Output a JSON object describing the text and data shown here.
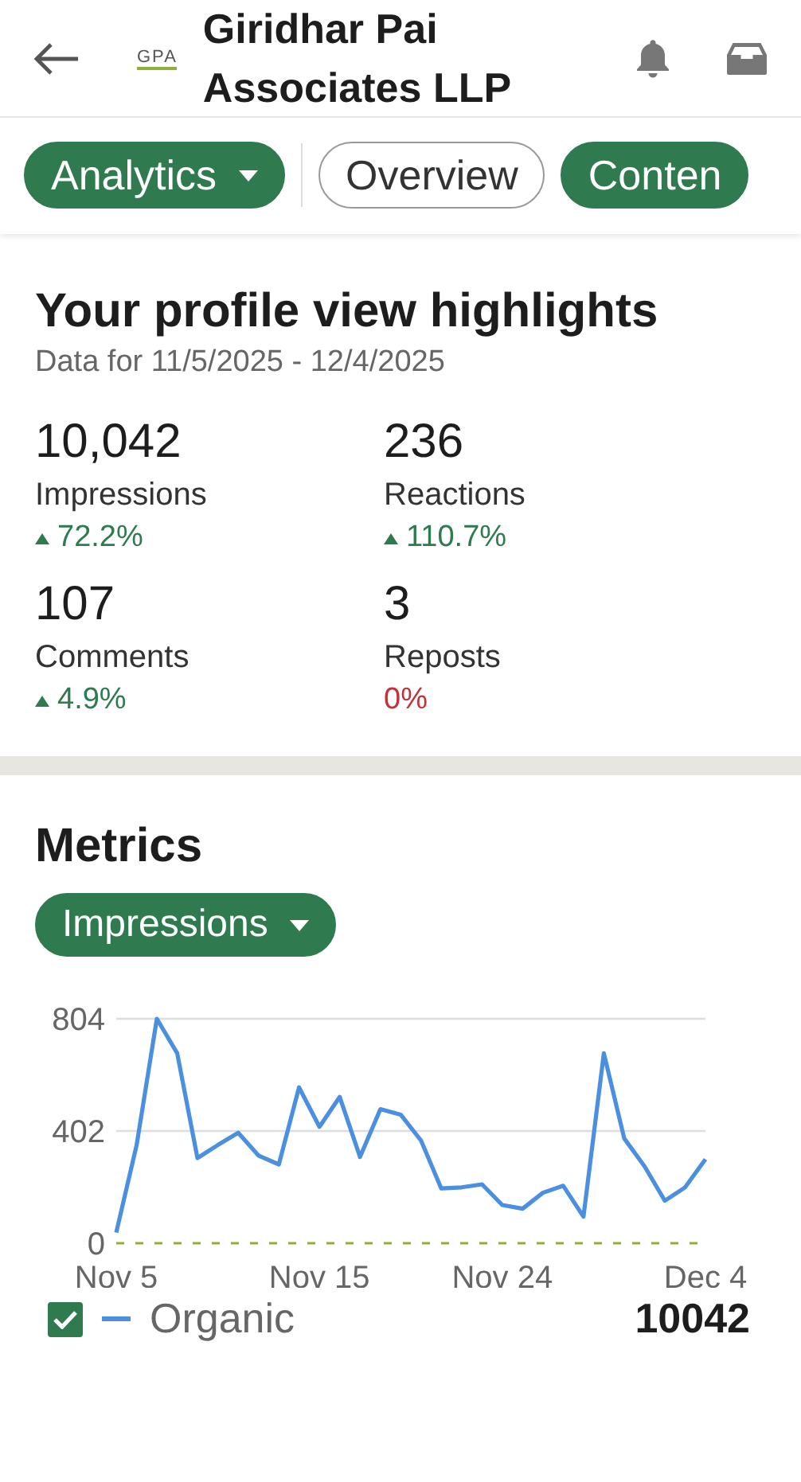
{
  "header": {
    "logo_text": "GPA",
    "title": "Giridhar Pai Associates LLP"
  },
  "chips": [
    {
      "label": "Analytics",
      "kind": "menu"
    },
    {
      "label": "Overview",
      "kind": "outline"
    },
    {
      "label": "Conten",
      "kind": "filled"
    }
  ],
  "highlights": {
    "title": "Your profile view highlights",
    "subtitle": "Data for 11/5/2025 - 12/4/2025",
    "stats": [
      {
        "value": "10,042",
        "label": "Impressions",
        "change": "72.2%",
        "kind": "up"
      },
      {
        "value": "236",
        "label": "Reactions",
        "change": "110.7%",
        "kind": "up"
      },
      {
        "value": "107",
        "label": "Comments",
        "change": "4.9%",
        "kind": "up"
      },
      {
        "value": "3",
        "label": "Reposts",
        "change": "0%",
        "kind": "flat"
      }
    ]
  },
  "metrics": {
    "title": "Metrics",
    "dropdown": "Impressions",
    "chart_data": {
      "type": "line",
      "categories": [
        "Nov 5",
        null,
        null,
        null,
        null,
        null,
        null,
        null,
        null,
        null,
        "Nov 15",
        null,
        null,
        null,
        null,
        null,
        null,
        null,
        null,
        "Nov 24",
        null,
        null,
        null,
        null,
        null,
        null,
        null,
        null,
        null,
        "Dec 4"
      ],
      "series": [
        {
          "name": "Organic",
          "color": "#4a8fe0",
          "values": [
            38,
            352,
            804,
            680,
            305,
            352,
            396,
            314,
            282,
            558,
            417,
            524,
            309,
            480,
            461,
            368,
            196,
            200,
            211,
            137,
            124,
            181,
            206,
            95,
            680,
            375,
            276,
            152,
            200,
            301
          ]
        }
      ],
      "ylim": [
        0,
        804
      ],
      "yticks": [
        0,
        402,
        804
      ]
    },
    "legend": [
      {
        "checked": true,
        "total": "10042"
      }
    ]
  }
}
